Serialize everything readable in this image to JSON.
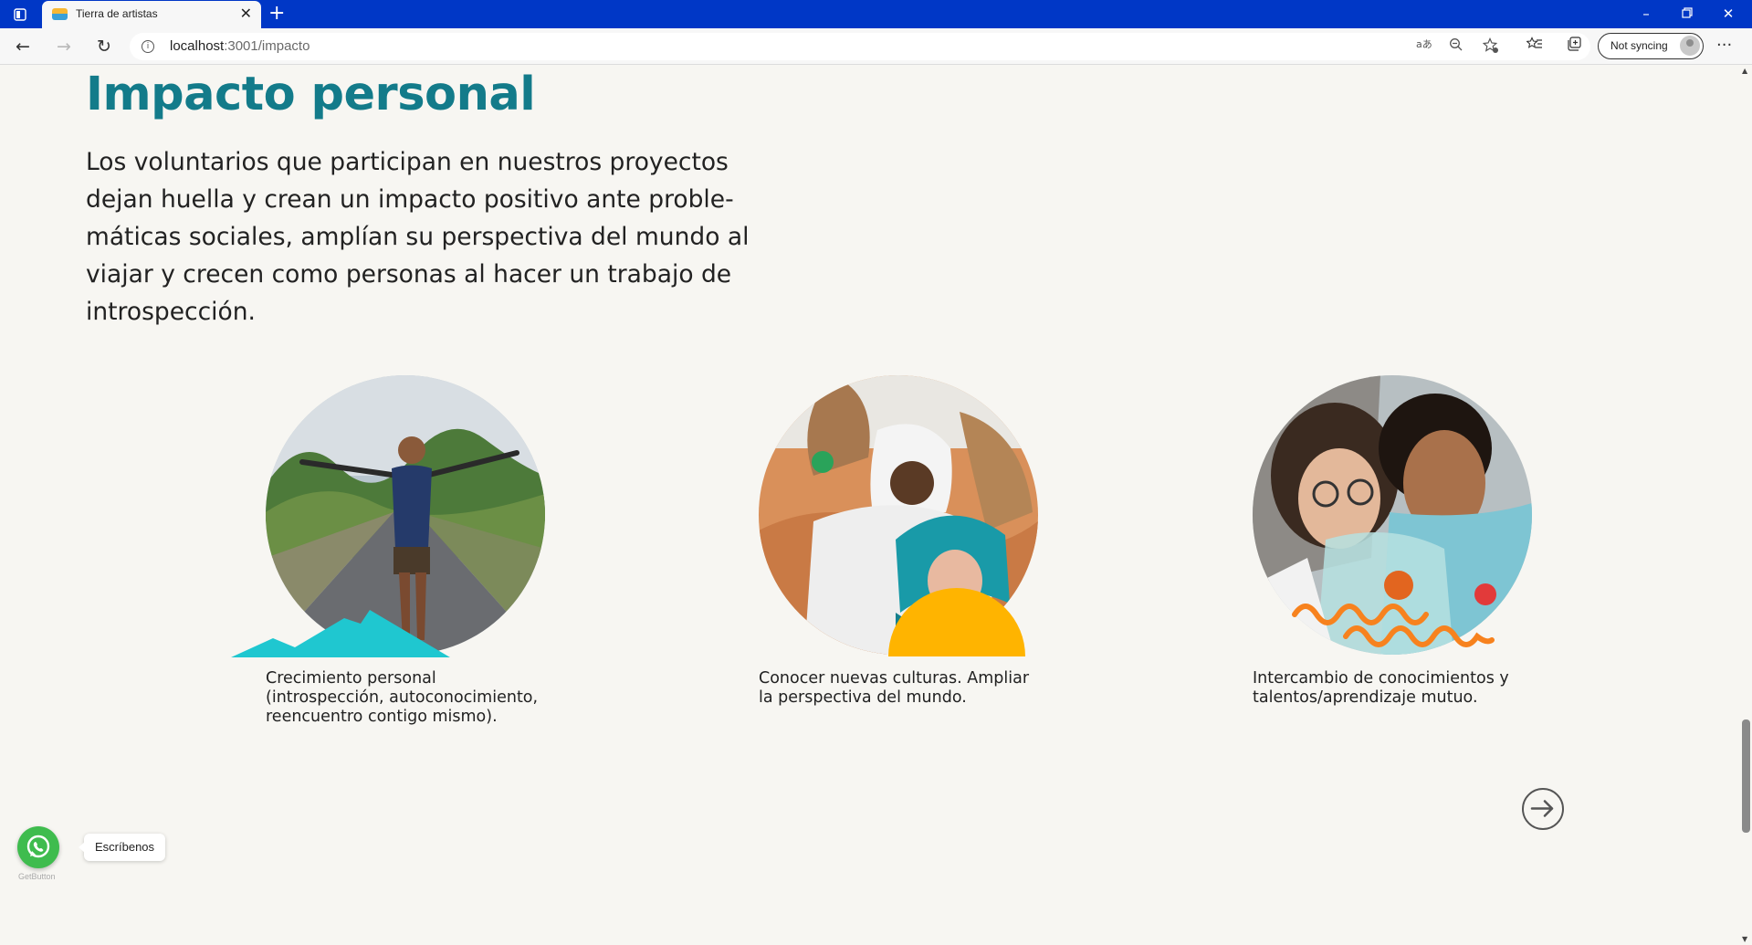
{
  "browser": {
    "tab_title": "Tierra de artistas",
    "url_host": "localhost",
    "url_path": ":3001/impacto",
    "sync_label": "Not syncing"
  },
  "page": {
    "heading": "Impacto personal",
    "intro": "Los voluntarios que participan en nuestros proyectos dejan huella y crean un impacto positivo ante problemáticas sociales, amplían su perspectiva del mundo al viajar y crecen como personas al hacer un trabajo de introspección.",
    "intro_lines": [
      "Los voluntarios que participan en nuestros proyectos",
      "dejan huella y crean un impacto positivo ante proble-",
      "máticas sociales, amplían su perspectiva del mundo al",
      "viajar y crecen como personas al hacer un trabajo de",
      "introspección."
    ],
    "cards": [
      {
        "caption_lines": [
          "Crecimiento personal",
          "(introspección, autoconocimiento,",
          "reencuentro contigo mismo)."
        ]
      },
      {
        "caption_lines": [
          "Conocer nuevas culturas. Ampliar",
          "la perspectiva del mundo."
        ]
      },
      {
        "caption_lines": [
          "Intercambio de conocimientos y",
          "talentos/aprendizaje mutuo."
        ]
      }
    ]
  },
  "whatsapp": {
    "label": "Escríbenos",
    "brand": "GetButton"
  },
  "colors": {
    "heading": "#137b8a",
    "titlebar": "#0037c6",
    "mountain": "#1fc7d0",
    "sun": "#ffb400",
    "squiggle": "#f7821e",
    "whatsapp": "#3fbc4e"
  }
}
